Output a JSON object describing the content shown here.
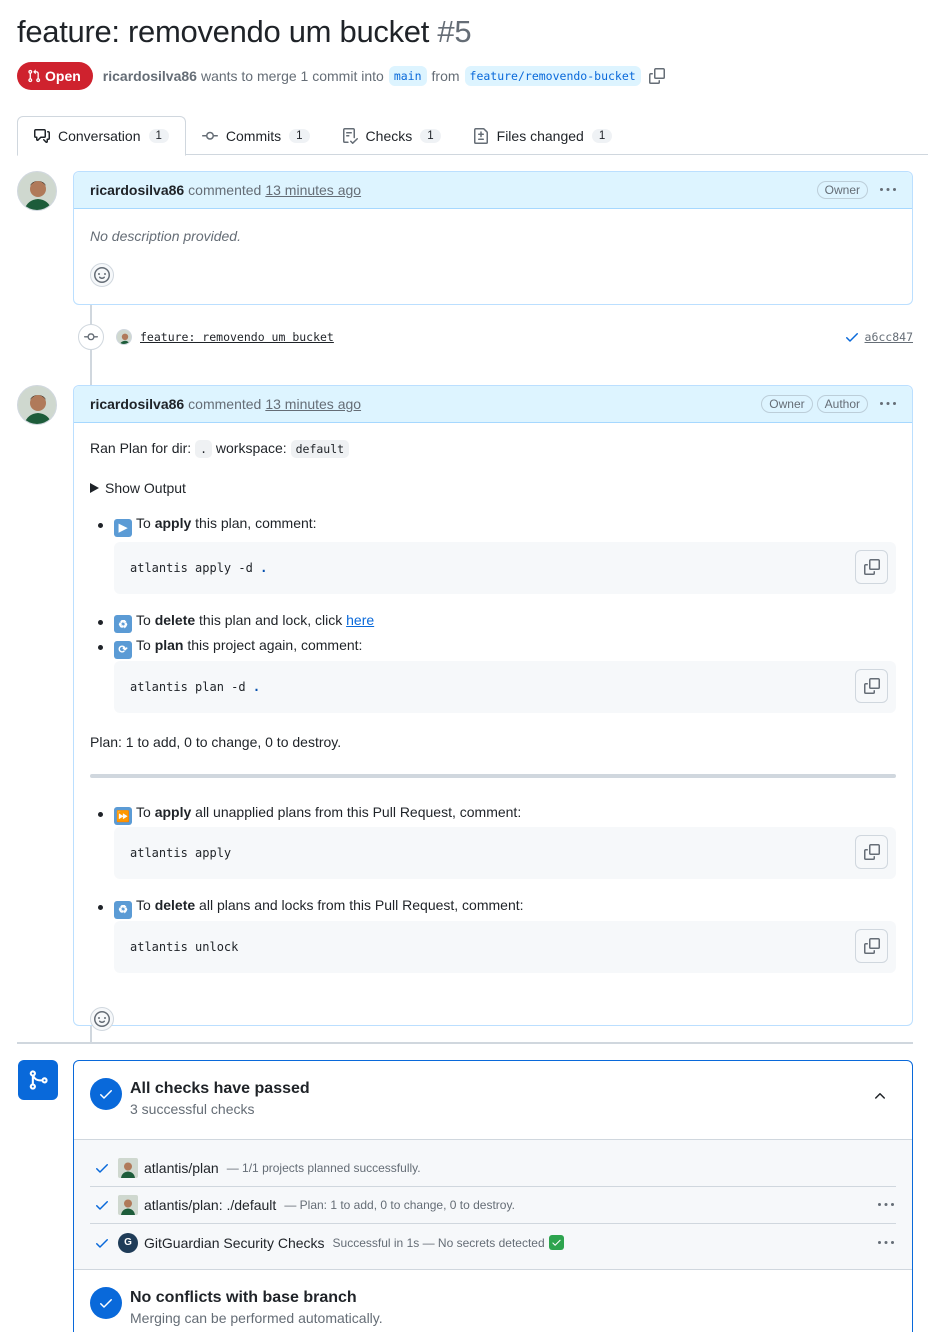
{
  "pr": {
    "title": "feature: removendo um bucket",
    "number": "#5",
    "state": "Open",
    "author": "ricardosilva86",
    "merge_text": "wants to merge 1 commit into",
    "base_branch": "main",
    "from_text": "from",
    "head_branch": "feature/removendo-bucket"
  },
  "tabs": [
    {
      "label": "Conversation",
      "count": "1"
    },
    {
      "label": "Commits",
      "count": "1"
    },
    {
      "label": "Checks",
      "count": "1"
    },
    {
      "label": "Files changed",
      "count": "1"
    }
  ],
  "comment1": {
    "author": "ricardosilva86",
    "action": "commented",
    "time": "13 minutes ago",
    "label_owner": "Owner",
    "body": "No description provided."
  },
  "commit": {
    "message": "feature: removendo um bucket",
    "sha": "a6cc847"
  },
  "comment2": {
    "author": "ricardosilva86",
    "action": "commented",
    "time": "13 minutes ago",
    "label_owner": "Owner",
    "label_author": "Author",
    "ran_plan_prefix": "Ran Plan for dir:",
    "dir": ".",
    "workspace_label": "workspace:",
    "workspace": "default",
    "show_output": "Show Output",
    "apply_pre": "To ",
    "apply_bold": "apply",
    "apply_post": " this plan, comment:",
    "apply_cmd": "atlantis apply -d",
    "cmd_dot": ".",
    "delete_pre": "To ",
    "delete_bold": "delete",
    "delete_mid": " this plan and lock, click ",
    "delete_link": "here",
    "plan_pre": "To ",
    "plan_bold": "plan",
    "plan_post": " this project again, comment:",
    "plan_cmd": "atlantis plan -d",
    "plan_summary": "Plan: 1 to add, 0 to change, 0 to destroy.",
    "apply_all_pre": "To ",
    "apply_all_bold": "apply",
    "apply_all_post": " all unapplied plans from this Pull Request, comment:",
    "apply_all_cmd": "atlantis apply",
    "delete_all_pre": "To ",
    "delete_all_bold": "delete",
    "delete_all_post": " all plans and locks from this Pull Request, comment:",
    "unlock_cmd": "atlantis unlock"
  },
  "merge_box": {
    "checks_title": "All checks have passed",
    "checks_sub": "3 successful checks",
    "checks": [
      {
        "name": "atlantis/plan",
        "desc": "— 1/1 projects planned successfully."
      },
      {
        "name": "atlantis/plan: ./default",
        "desc": "— Plan: 1 to add, 0 to change, 0 to destroy."
      },
      {
        "name": "GitGuardian Security Checks",
        "desc": "Successful in 1s — No secrets detected"
      }
    ],
    "conflict_title": "No conflicts with base branch",
    "conflict_sub": "Merging can be performed automatically."
  },
  "colors": {
    "accent": "#0969da",
    "danger": "#cf222e",
    "header_bg": "#ddf4ff"
  }
}
